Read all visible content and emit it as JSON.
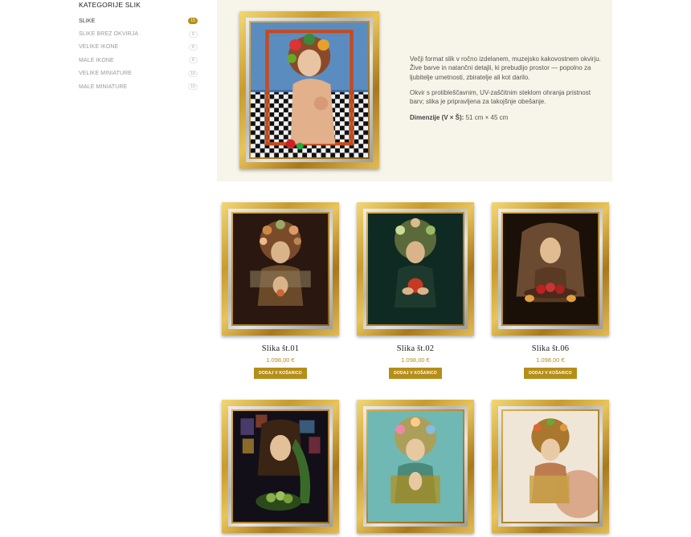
{
  "sidebar": {
    "title": "KATEGORIJE SLIK",
    "items": [
      {
        "label": "SLIKE",
        "count": "15",
        "active": true
      },
      {
        "label": "SLIKE BREZ OKVIRJA",
        "count": "9"
      },
      {
        "label": "VELIKE IKONE",
        "count": "8"
      },
      {
        "label": "MALE IKONE",
        "count": "8"
      },
      {
        "label": "VELIKE MINIATURE",
        "count": "10"
      },
      {
        "label": "MALE MINIATURE",
        "count": "10"
      }
    ]
  },
  "hero": {
    "paragraph1": "Večji format slik v ročno izdelanem, muzejsko kakovostnem okvirju. Žive barve in natančni detajli, ki prebudijo prostor — popolno za ljubitelje umetnosti, zbiratelje ali kot darilo.",
    "paragraph2": "Okvir s protibleščavnim, UV-zaščitnim steklom ohranja pristnost barv; slika je pripravljena za takojšnje obešanje.",
    "dimensions_label": "Dimenzije (V × Š):",
    "dimensions_value": "51 cm × 45 cm"
  },
  "products": [
    {
      "title": "Slika št.01",
      "price": "1.098,00 €",
      "button": "DODAJ V KOŠARICO"
    },
    {
      "title": "Slika št.02",
      "price": "1.098,00 €",
      "button": "DODAJ V KOŠARICO"
    },
    {
      "title": "Slika št.06",
      "price": "1.098,00 €",
      "button": "DODAJ V KOŠARICO"
    },
    {
      "title": "",
      "price": "",
      "button": ""
    },
    {
      "title": "",
      "price": "",
      "button": ""
    },
    {
      "title": "",
      "price": "",
      "button": ""
    }
  ],
  "colors": {
    "accent": "#b58e1a",
    "hero_background": "#f7f4e9"
  }
}
